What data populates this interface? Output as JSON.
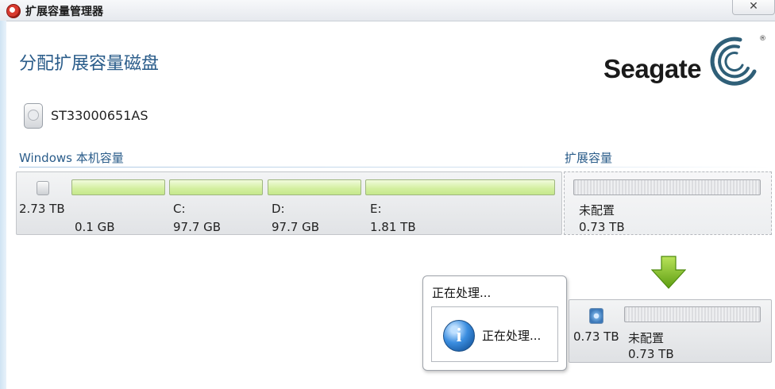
{
  "window": {
    "title": "扩展容量管理器",
    "close_glyph": "✕"
  },
  "page": {
    "heading": "分配扩展容量磁盘"
  },
  "brand": {
    "name": "Seagate",
    "mark": "®",
    "accent": "#2f5f78"
  },
  "disk": {
    "model": "ST33000651AS",
    "total_size": "2.73 TB"
  },
  "sections": {
    "windows_capacity": "Windows 本机容量",
    "extended_capacity": "扩展容量"
  },
  "partitions": [
    {
      "letter": "",
      "size": "0.1 GB"
    },
    {
      "letter": "C:",
      "size": "97.7 GB"
    },
    {
      "letter": "D:",
      "size": "97.7 GB"
    },
    {
      "letter": "E:",
      "size": "1.81 TB"
    }
  ],
  "extended": {
    "status": "未配置",
    "size": "0.73 TB"
  },
  "dialog": {
    "title": "正在处理...",
    "message": "正在处理...",
    "icon": "info-icon"
  },
  "new_volume": {
    "total": "0.73 TB",
    "status": "未配置",
    "size": "0.73 TB"
  },
  "colors": {
    "partition_fill": "#d2ef9e",
    "heading": "#2a5c8a",
    "arrow": "#7dbb1e"
  }
}
